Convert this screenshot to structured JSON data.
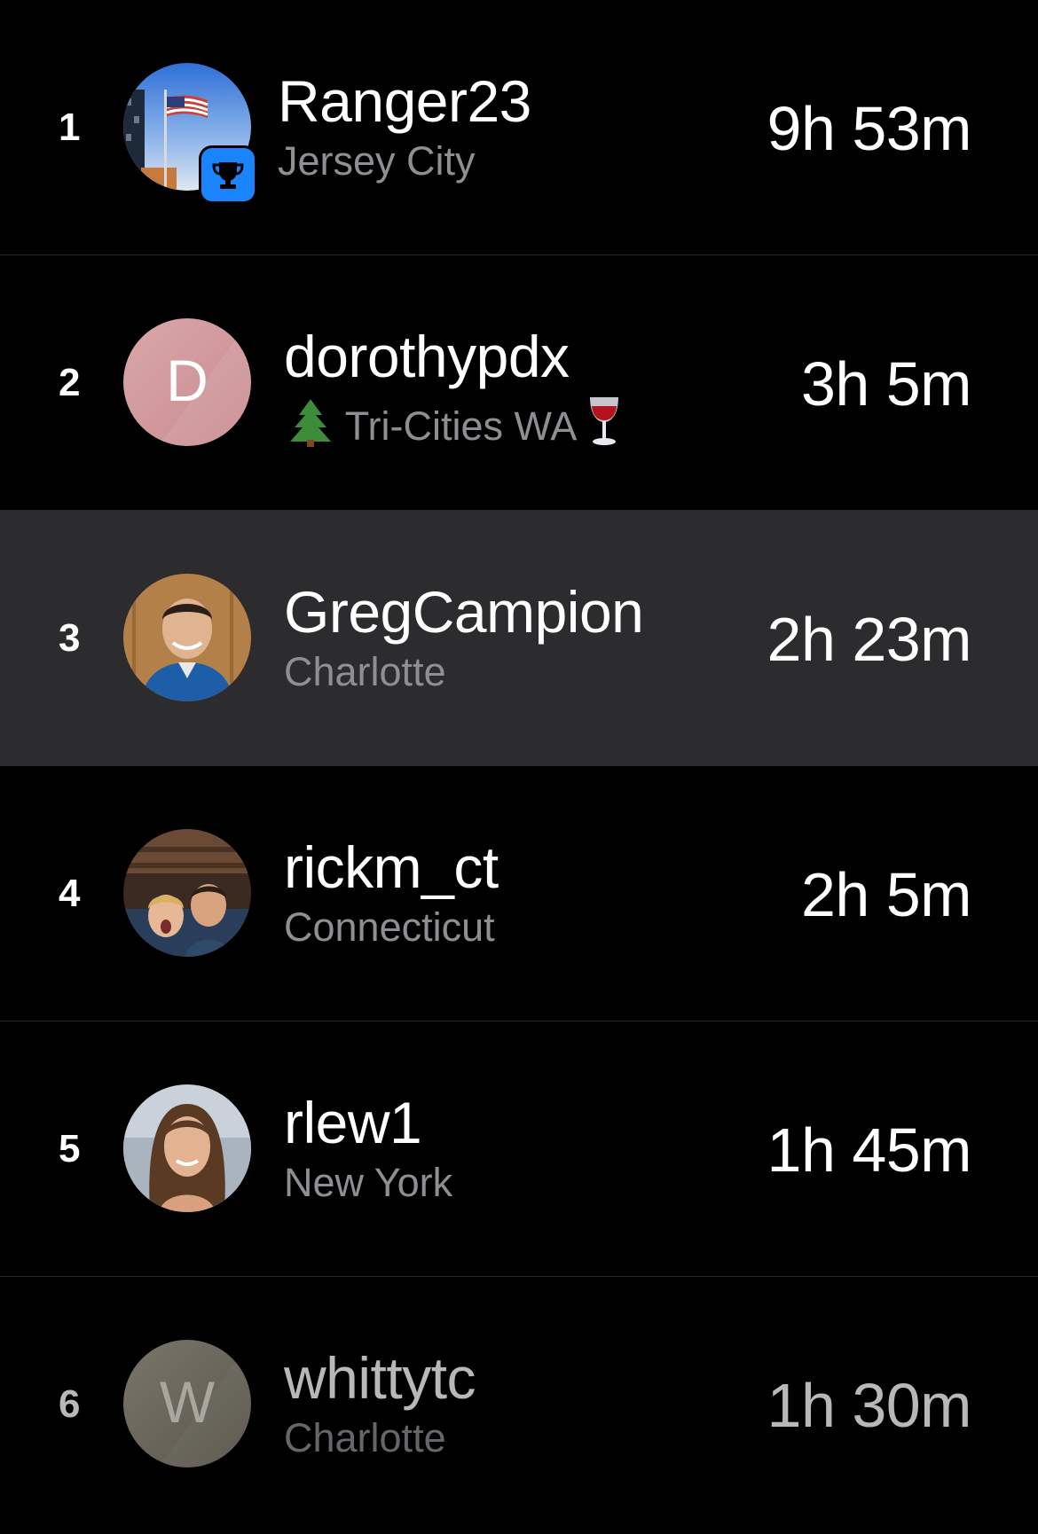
{
  "leaderboard": {
    "rows": [
      {
        "rank": "1",
        "username": "Ranger23",
        "location": "Jersey City",
        "time": "9h 53m",
        "avatar": "flag-photo",
        "badge": "trophy-icon"
      },
      {
        "rank": "2",
        "username": "dorothypdx",
        "location_prefix_icon": "evergreen-tree-emoji",
        "location": "Tri-Cities WA",
        "location_suffix_icon": "wine-glass-emoji",
        "time": "3h 5m",
        "avatar_initial": "D",
        "avatar_color": "#d4a0a4"
      },
      {
        "rank": "3",
        "username": "GregCampion",
        "location": "Charlotte",
        "time": "2h 23m",
        "avatar": "portrait-photo",
        "highlighted": true
      },
      {
        "rank": "4",
        "username": "rickm_ct",
        "location": "Connecticut",
        "time": "2h 5m",
        "avatar": "family-photo"
      },
      {
        "rank": "5",
        "username": "rlew1",
        "location": "New York",
        "time": "1h 45m",
        "avatar": "portrait-photo"
      },
      {
        "rank": "6",
        "username": "whittytc",
        "location": "Charlotte",
        "time": "1h 30m",
        "avatar_initial": "W",
        "avatar_color": "#8f8a7c"
      }
    ]
  },
  "colors": {
    "background": "#000000",
    "highlight_row": "#2c2c2e",
    "secondary_text": "#8e8e93",
    "badge_blue": "#1a84ff"
  }
}
